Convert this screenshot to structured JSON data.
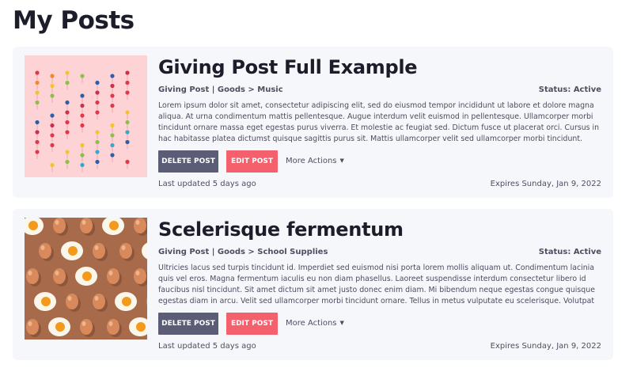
{
  "page": {
    "title": "My Posts"
  },
  "posts": [
    {
      "title": "Giving Post Full Example",
      "category": "Giving Post | Goods > Music",
      "status": "Status: Active",
      "description": "Lorem ipsum dolor sit amet, consectetur adipiscing elit, sed do eiusmod tempor incididunt ut labore et dolore magna aliqua. At urna condimentum mattis pellentesque. Augue interdum velit euismod in pellentesque. Ullamcorper morbi tincidunt ornare massa eget egestas purus viverra. Et molestie ac feugiat sed. Dictum fusce ut placerat orci. Cursus in hac habitasse platea dictumst quisque sagittis purus sit. Mattis ullamcorper velit sed ullamcorper morbi tincidunt. Lacus",
      "delete_label": "DELETE POST",
      "edit_label": "EDIT POST",
      "more_actions_label": "More Actions",
      "last_updated": "Last updated 5 days ago",
      "expires": "Expires Sunday, Jan 9, 2022",
      "image": "push-pins-on-pink-image"
    },
    {
      "title": "Scelerisque fermentum",
      "category": "Giving Post | Goods > School Supplies",
      "status": "Status: Active",
      "description": "Ultricies lacus sed turpis tincidunt id. Imperdiet sed euismod nisi porta lorem mollis aliquam ut. Condimentum lacinia quis vel eros. Magna fermentum iaculis eu non diam phasellus. Laoreet suspendisse interdum consectetur libero id faucibus nisl tincidunt. Sit amet dictum sit amet justo donec enim diam. Mi bibendum neque egestas congue quisque egestas diam in arcu. Velit sed ullamcorper morbi tincidunt ornare. Tellus in metus vulputate eu scelerisque. Volutpat ac",
      "delete_label": "DELETE POST",
      "edit_label": "EDIT POST",
      "more_actions_label": "More Actions",
      "last_updated": "Last updated 5 days ago",
      "expires": "Expires Sunday, Jan 9, 2022",
      "image": "eggs-and-fried-eggs-image"
    }
  ],
  "colors": {
    "card_background": "#f6f7fb",
    "delete_button": "#5b5c75",
    "edit_button": "#f4606c",
    "title_text": "#1c1d2a",
    "meta_text": "#4c4f60"
  }
}
